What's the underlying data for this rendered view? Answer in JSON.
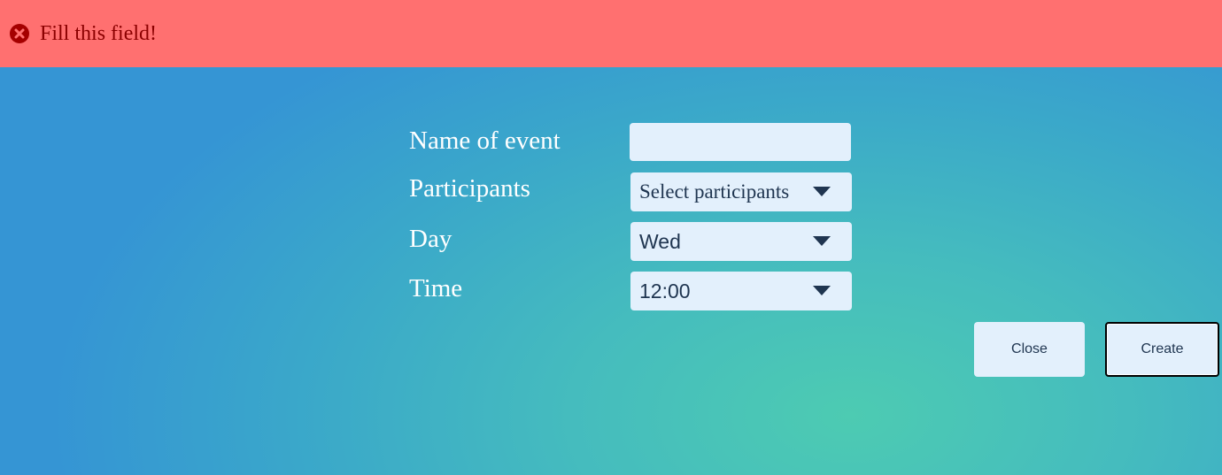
{
  "error": {
    "icon": "error-circle-x-icon",
    "message": "Fill this field!"
  },
  "form": {
    "name_label": "Name of event",
    "name_value": "",
    "participants_label": "Participants",
    "participants_value": "Select participants",
    "day_label": "Day",
    "day_value": "Wed",
    "time_label": "Time",
    "time_value": "12:00"
  },
  "buttons": {
    "close": "Close",
    "create": "Create"
  },
  "colors": {
    "error_bg": "#ff7070",
    "error_text": "#8b0000",
    "field_bg": "#e3f0fc",
    "field_text": "#1f3550"
  }
}
